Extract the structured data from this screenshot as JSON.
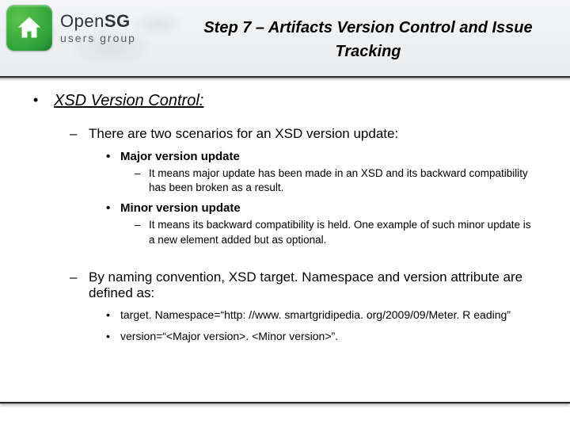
{
  "logo": {
    "brand_prefix": "Open",
    "brand_suffix": "SG",
    "subtitle": "users group",
    "icon": "house-icon"
  },
  "title": "Step 7 – Artifacts Version Control and Issue Tracking",
  "content": {
    "heading": "XSD Version Control:",
    "scenario_intro": "There are two scenarios for an XSD version update:",
    "major_label": "Major version update",
    "major_desc": "It means major update has been made in an XSD and its backward compatibility has been broken as a result.",
    "minor_label": "Minor version update",
    "minor_desc": "It means its backward compatibility is held. One example of such minor update is a new element added but as optional.",
    "naming_intro": "By naming convention, XSD target. Namespace and version attribute are defined as:",
    "naming_ns": "target. Namespace=“http: //www. smartgridipedia. org/2009/09/Meter. R eading”",
    "naming_ver": "version=“<Major version>. <Minor version>”."
  }
}
